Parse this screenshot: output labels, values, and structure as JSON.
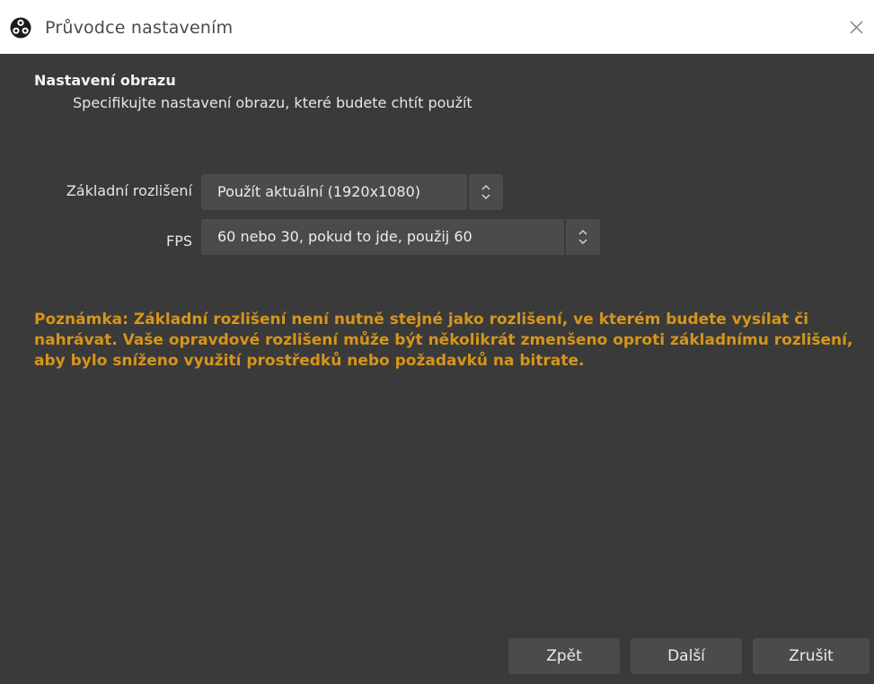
{
  "window": {
    "title": "Průvodce nastavením",
    "icon": "obs-logo-icon",
    "close_icon": "close-icon"
  },
  "page": {
    "heading": "Nastavení obrazu",
    "subheading": "Specifikujte nastavení obrazu, které budete chtít použít"
  },
  "fields": {
    "base_resolution": {
      "label": "Základní rozlišení",
      "value": "Použít aktuální (1920x1080)"
    },
    "fps": {
      "label": "FPS",
      "value": "60 nebo 30, pokud to jde, použij 60"
    }
  },
  "note": "Poznámka: Základní rozlišení není nutně stejné jako rozlišení, ve kterém budete vysílat či nahrávat. Vaše opravdové rozlišení může být několikrát zmenšeno oproti základnímu rozlišení, aby bylo sníženo využití prostředků nebo požadavků na bitrate.",
  "buttons": {
    "back": "Zpět",
    "next": "Další",
    "cancel": "Zrušit"
  },
  "colors": {
    "background": "#3a3a3a",
    "control": "#4b4b4b",
    "note_text": "#d6951a",
    "titlebar": "#ffffff"
  }
}
